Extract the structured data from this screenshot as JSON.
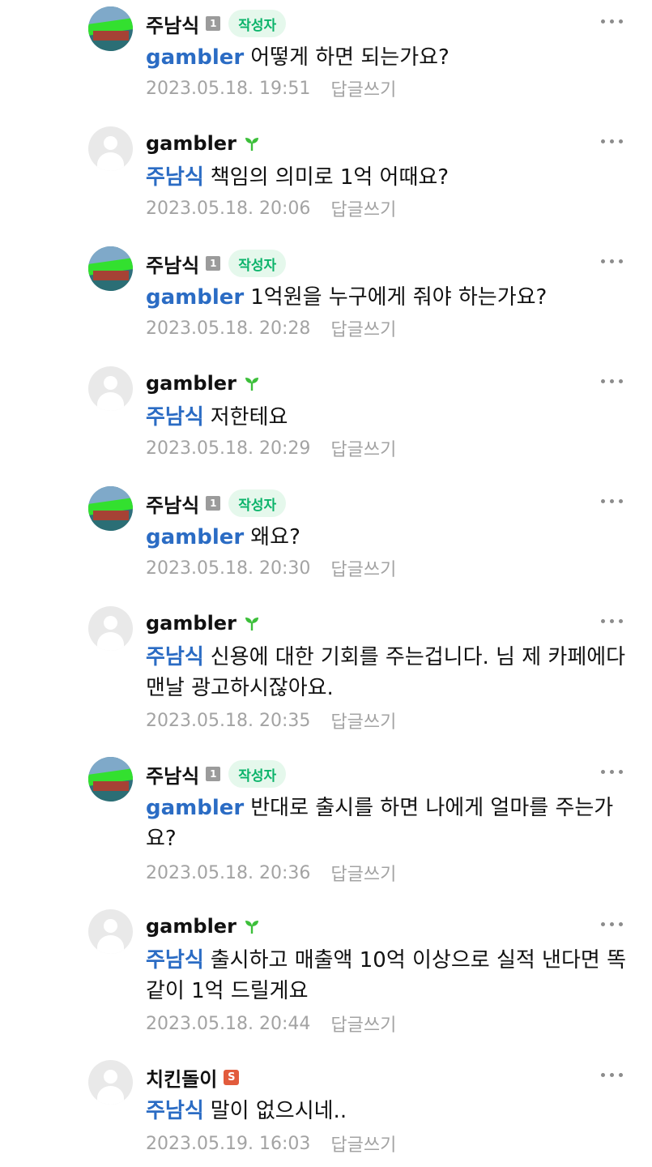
{
  "comments": [
    {
      "nick": "주남식",
      "type": "writer",
      "level": "1",
      "writer_label": "작성자",
      "mention": "gambler",
      "text": "어떻게 하면 되는가요?",
      "time": "2023.05.18. 19:51",
      "reply": "답글쓰기"
    },
    {
      "nick": "gambler",
      "type": "member",
      "mention": "주남식",
      "text": "책임의 의미로 1억 어때요?",
      "time": "2023.05.18. 20:06",
      "reply": "답글쓰기"
    },
    {
      "nick": "주남식",
      "type": "writer",
      "level": "1",
      "writer_label": "작성자",
      "mention": "gambler",
      "text": "1억원을 누구에게 줘야 하는가요?",
      "time": "2023.05.18. 20:28",
      "reply": "답글쓰기"
    },
    {
      "nick": "gambler",
      "type": "member",
      "mention": "주남식",
      "text": "저한테요",
      "time": "2023.05.18. 20:29",
      "reply": "답글쓰기"
    },
    {
      "nick": "주남식",
      "type": "writer",
      "level": "1",
      "writer_label": "작성자",
      "mention": "gambler",
      "text": "왜요?",
      "time": "2023.05.18. 20:30",
      "reply": "답글쓰기"
    },
    {
      "nick": "gambler",
      "type": "member",
      "mention": "주남식",
      "text": "신용에 대한 기회를 주는겁니다. 님 제 카페에다 맨날 광고하시잖아요.",
      "time": "2023.05.18. 20:35",
      "reply": "답글쓰기"
    },
    {
      "nick": "주남식",
      "type": "writer",
      "level": "1",
      "writer_label": "작성자",
      "mention": "gambler",
      "text": "반대로 출시를 하면 나에게 얼마를 주는가요?",
      "time": "2023.05.18. 20:36",
      "reply": "답글쓰기"
    },
    {
      "nick": "gambler",
      "type": "member",
      "mention": "주남식",
      "text": "출시하고 매출액 10억 이상으로 실적 낸다면 똑같이 1억 드릴게요",
      "time": "2023.05.18. 20:44",
      "reply": "답글쓰기"
    },
    {
      "nick": "치킨돌이",
      "type": "staff",
      "staff_badge": "S",
      "mention": "주남식",
      "text": "말이 없으시네..",
      "time": "2023.05.19. 16:03",
      "reply": "답글쓰기"
    }
  ]
}
